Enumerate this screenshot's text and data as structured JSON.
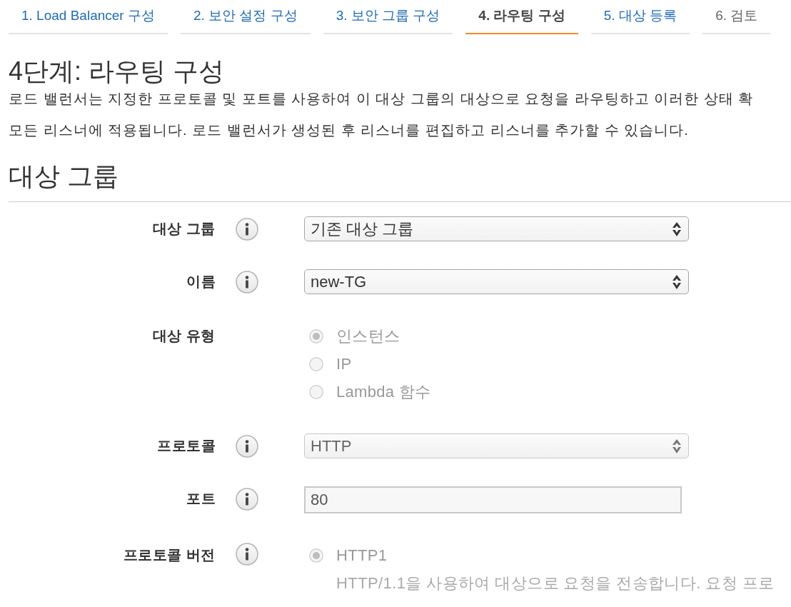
{
  "tabs": [
    {
      "label": "1. Load Balancer 구성",
      "selected": false,
      "disabled": false
    },
    {
      "label": "2. 보안 설정 구성",
      "selected": false,
      "disabled": false
    },
    {
      "label": "3. 보안 그룹 구성",
      "selected": false,
      "disabled": false
    },
    {
      "label": "4. 라우팅 구성",
      "selected": true,
      "disabled": false
    },
    {
      "label": "5. 대상 등록",
      "selected": false,
      "disabled": false
    },
    {
      "label": "6. 검토",
      "selected": false,
      "disabled": true
    }
  ],
  "page": {
    "title": "4단계: 라우팅 구성",
    "description_lines": [
      "로드 밸런서는 지정한 프로토콜 및 포트를 사용하여 이 대상 그룹의 대상으로 요청을 라우팅하고 이러한 상태 확",
      "모든 리스너에 적용됩니다. 로드 밸런서가 생성된 후 리스너를 편집하고 리스너를 추가할 수 있습니다."
    ]
  },
  "section": {
    "title": "대상 그룹",
    "fields": [
      {
        "kind": "select",
        "label": "대상 그룹",
        "info": true,
        "value": "기존 대상 그룹",
        "disabled": false
      },
      {
        "kind": "select",
        "label": "이름",
        "info": true,
        "value": "new-TG",
        "disabled": false
      },
      {
        "kind": "radio",
        "label": "대상 유형",
        "info": false,
        "disabled": true,
        "options": [
          {
            "label": "인스턴스",
            "selected": true
          },
          {
            "label": "IP",
            "selected": false
          },
          {
            "label": "Lambda 함수",
            "selected": false
          }
        ]
      },
      {
        "kind": "select",
        "label": "프로토콜",
        "info": true,
        "value": "HTTP",
        "disabled": true
      },
      {
        "kind": "input",
        "label": "포트",
        "info": true,
        "value": "80",
        "disabled": true
      },
      {
        "kind": "radio",
        "label": "프로토콜 버전",
        "info": true,
        "disabled": true,
        "options": [
          {
            "label": "HTTP1",
            "selected": true,
            "description": "HTTP/1.1을 사용하여 대상으로 요청을 전송합니다. 요청 프로"
          }
        ]
      }
    ]
  }
}
